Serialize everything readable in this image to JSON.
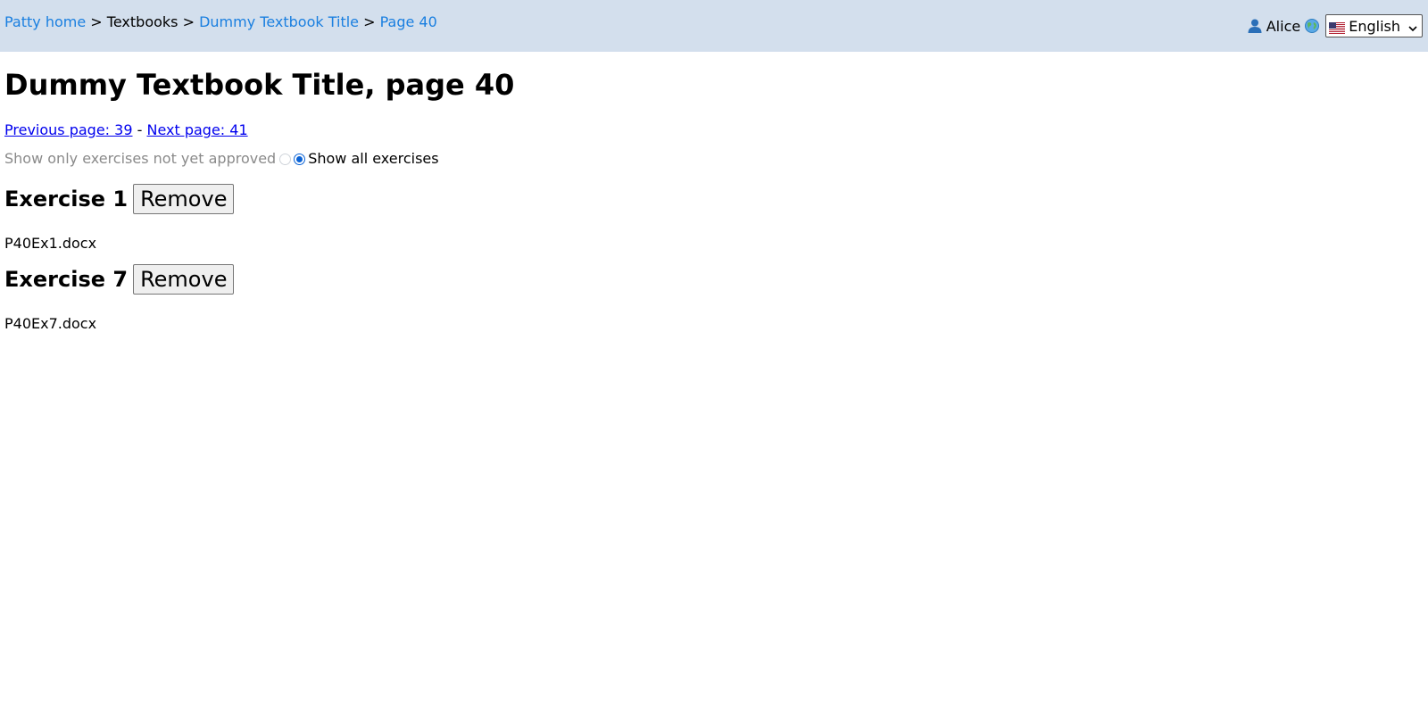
{
  "header": {
    "breadcrumb": {
      "home": "Patty home",
      "textbooks": "Textbooks",
      "textbook": "Dummy Textbook Title",
      "page": "Page 40",
      "separator": ">"
    },
    "user": {
      "name": "Alice",
      "icon": "user-icon"
    },
    "language": {
      "icon": "globe-icon",
      "flag": "us-flag-icon",
      "selected": "English"
    }
  },
  "main": {
    "title": "Dummy Textbook Title, page 40",
    "pager": {
      "previous": "Previous page: 39",
      "dash": "-",
      "next": "Next page: 41"
    },
    "filter": {
      "option_unapproved": "Show only exercises not yet approved",
      "option_all": "Show all exercises",
      "selected": "all"
    },
    "exercises": [
      {
        "title": "Exercise 1",
        "remove_label": "Remove",
        "file": "P40Ex1.docx"
      },
      {
        "title": "Exercise 7",
        "remove_label": "Remove",
        "file": "P40Ex7.docx"
      }
    ]
  },
  "colors": {
    "topbar_bg": "#d3dfed",
    "breadcrumb_link": "#1a7fe0",
    "link": "#0000ee",
    "radio_accent": "#0b63d6"
  }
}
